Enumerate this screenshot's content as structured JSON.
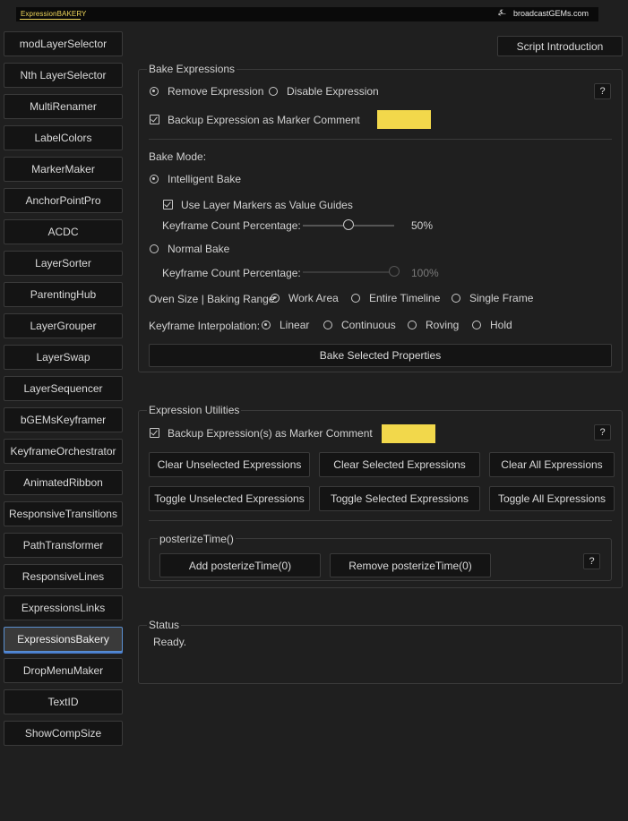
{
  "header": {
    "logo_text": "ExpressionBAKERY",
    "brand_text": "broadcastGEMs.com",
    "brand_icon": "bgems-icon"
  },
  "sidebar": {
    "items": [
      {
        "label": "modLayerSelector"
      },
      {
        "label": "Nth LayerSelector"
      },
      {
        "label": "MultiRenamer"
      },
      {
        "label": "LabelColors"
      },
      {
        "label": "MarkerMaker"
      },
      {
        "label": "AnchorPointPro"
      },
      {
        "label": "ACDC"
      },
      {
        "label": "LayerSorter"
      },
      {
        "label": "ParentingHub"
      },
      {
        "label": "LayerGrouper"
      },
      {
        "label": "LayerSwap"
      },
      {
        "label": "LayerSequencer"
      },
      {
        "label": "bGEMsKeyframer"
      },
      {
        "label": "KeyframeOrchestrator"
      },
      {
        "label": "AnimatedRibbon"
      },
      {
        "label": "ResponsiveTransitions"
      },
      {
        "label": "PathTransformer"
      },
      {
        "label": "ResponsiveLines"
      },
      {
        "label": "ExpressionsLinks"
      },
      {
        "label": "ExpressionsBakery",
        "active": true
      },
      {
        "label": "DropMenuMaker"
      },
      {
        "label": "TextID"
      },
      {
        "label": "ShowCompSize"
      }
    ]
  },
  "script_intro_label": "Script Introduction",
  "bake": {
    "title": "Bake Expressions",
    "remove_label": "Remove Expression",
    "disable_label": "Disable Expression",
    "help_label": "?",
    "backup_label": "Backup Expression as Marker Comment",
    "swatch_color": "#f2d84b",
    "mode_label": "Bake Mode:",
    "intelligent_label": "Intelligent Bake",
    "use_markers_label": "Use Layer Markers as Value Guides",
    "kf_pct_label": "Keyframe Count Percentage:",
    "kf_pct_value": "50%",
    "kf_pct_fraction": 0.5,
    "normal_label": "Normal Bake",
    "kf_pct_label2": "Keyframe Count Percentage:",
    "kf_pct_value2": "100%",
    "kf_pct_fraction2": 1.0,
    "oven_label": "Oven Size | Baking Range:",
    "range_options": [
      "Work Area",
      "Entire Timeline",
      "Single Frame"
    ],
    "range_selected": "Work Area",
    "interp_label": "Keyframe Interpolation:",
    "interp_options": [
      "Linear",
      "Continuous",
      "Roving",
      "Hold"
    ],
    "interp_selected": "Linear",
    "bake_button": "Bake Selected Properties"
  },
  "utils": {
    "title": "Expression Utilities",
    "backup_label": "Backup Expression(s) as Marker Comment",
    "help_label": "?",
    "clear_unselected": "Clear Unselected Expressions",
    "clear_selected": "Clear Selected Expressions",
    "clear_all": "Clear All Expressions",
    "toggle_unselected": "Toggle Unselected Expressions",
    "toggle_selected": "Toggle Selected Expressions",
    "toggle_all": "Toggle All Expressions",
    "posterize_title": "posterizeTime()",
    "add_posterize": "Add posterizeTime(0)",
    "remove_posterize": "Remove posterizeTime(0)",
    "posterize_help": "?"
  },
  "status": {
    "title": "Status",
    "text": "Ready."
  }
}
